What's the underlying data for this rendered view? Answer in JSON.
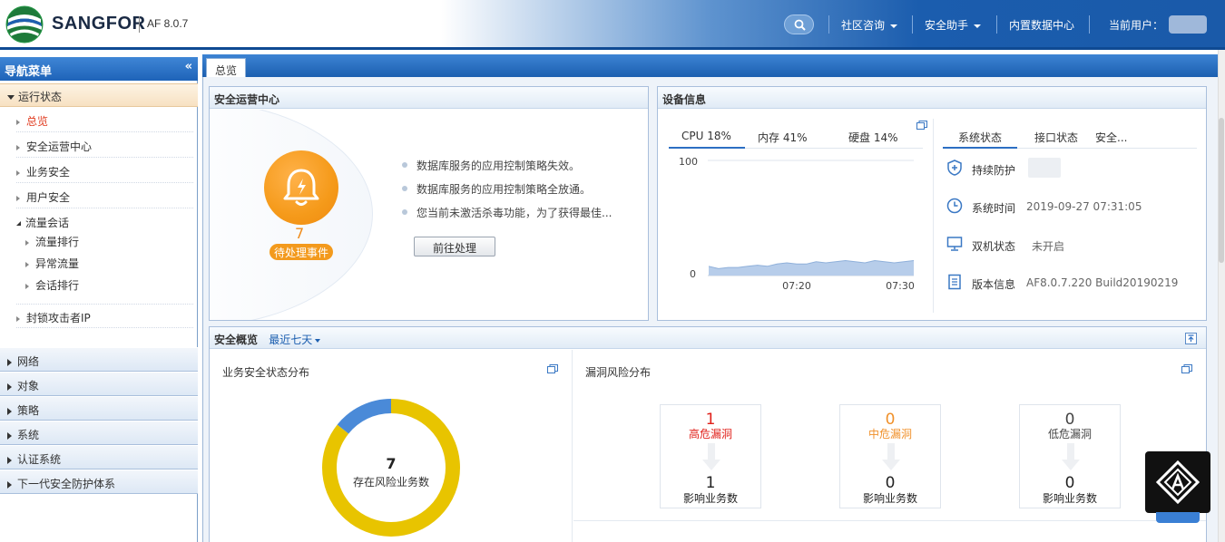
{
  "header": {
    "brand": "SANGFOR",
    "version": "AF 8.0.7",
    "nav": [
      {
        "label": "社区咨询",
        "dropdown": true
      },
      {
        "label": "安全助手",
        "dropdown": true
      },
      {
        "label": "内置数据中心",
        "dropdown": false
      }
    ],
    "current_user_label": "当前用户："
  },
  "sidebar": {
    "title": "导航菜单",
    "collapse_glyph": "«",
    "open_section": "运行状态",
    "items": [
      {
        "label": "总览",
        "active": true
      },
      {
        "label": "安全运营中心"
      },
      {
        "label": "业务安全"
      },
      {
        "label": "用户安全"
      }
    ],
    "traffic_group": {
      "label": "流量会话",
      "children": [
        "流量排行",
        "异常流量",
        "会话排行"
      ]
    },
    "block_item": "封锁攻击者IP",
    "sections": [
      "网络",
      "对象",
      "策略",
      "系统",
      "认证系统",
      "下一代安全防护体系"
    ]
  },
  "tabs": [
    {
      "label": "总览"
    }
  ],
  "soc": {
    "title": "安全运营中心",
    "pending_count": "7",
    "pending_label": "待处理事件",
    "messages": [
      "数据库服务的应用控制策略失效。",
      "数据库服务的应用控制策略全放通。",
      "您当前未激活杀毒功能，为了获得最佳..."
    ],
    "action_button": "前往处理"
  },
  "device": {
    "title": "设备信息",
    "metric_tabs": [
      {
        "label": "CPU 18%",
        "active": true
      },
      {
        "label": "内存 41%"
      },
      {
        "label": "硬盘 14%"
      }
    ],
    "status_tabs": [
      {
        "label": "系统状态",
        "active": true
      },
      {
        "label": "接口状态"
      },
      {
        "label": "安全..."
      }
    ],
    "info": [
      {
        "label": "持续防护",
        "value": "",
        "icon": "shield-icon"
      },
      {
        "label": "系统时间",
        "value": "2019-09-27 07:31:05",
        "icon": "clock-icon"
      },
      {
        "label": "双机状态",
        "value": "未开启",
        "icon": "monitor-icon"
      },
      {
        "label": "版本信息",
        "value": "AF8.0.7.220 Build20190219",
        "icon": "document-icon"
      }
    ]
  },
  "chart_data": {
    "type": "area",
    "title": "",
    "y_ticks": [
      "100",
      "0"
    ],
    "x_ticks": [
      "07:20",
      "07:30"
    ],
    "ylim": [
      0,
      100
    ],
    "x": [
      "07:10",
      "07:11",
      "07:12",
      "07:13",
      "07:14",
      "07:15",
      "07:16",
      "07:17",
      "07:18",
      "07:19",
      "07:20",
      "07:21",
      "07:22",
      "07:23",
      "07:24",
      "07:25",
      "07:26",
      "07:27",
      "07:28",
      "07:29",
      "07:30",
      "07:31"
    ],
    "series": [
      {
        "values": [
          8,
          6,
          7,
          7,
          8,
          9,
          8,
          10,
          11,
          10,
          10,
          12,
          11,
          12,
          13,
          12,
          11,
          13,
          12,
          11,
          12,
          13
        ]
      }
    ],
    "color": "#b7cdea"
  },
  "overview": {
    "title": "安全概览",
    "range_label": "最近七天",
    "business_title": "业务安全状态分布",
    "donut_count": "7",
    "donut_label": "存在风险业务数",
    "donut_slices": [
      {
        "value": 6,
        "color": "#e8c400"
      },
      {
        "value": 1,
        "color": "#4a8ad8"
      }
    ],
    "vuln_title": "漏洞风险分布",
    "vuln_boxes": [
      {
        "count": "1",
        "label": "高危漏洞",
        "color": "#e0201a",
        "affected": "1",
        "affected_label": "影响业务数"
      },
      {
        "count": "0",
        "label": "中危漏洞",
        "color": "#f0902a",
        "affected": "0",
        "affected_label": "影响业务数"
      },
      {
        "count": "0",
        "label": "低危漏洞",
        "color": "#444444",
        "affected": "0",
        "affected_label": "影响业务数"
      }
    ]
  }
}
